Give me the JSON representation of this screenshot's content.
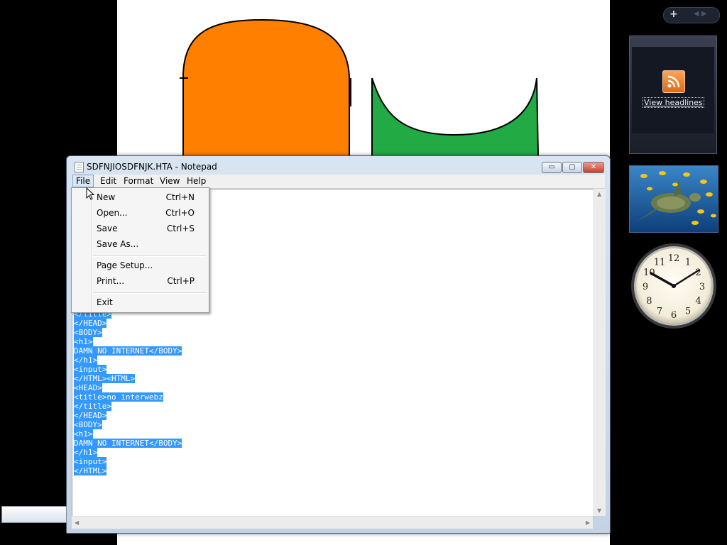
{
  "window": {
    "title": "SDFNJIOSDFNJK.HTA - Notepad",
    "min_glyph": "▭",
    "max_glyph": "▢",
    "close_glyph": "✕"
  },
  "menubar": [
    "File",
    "Edit",
    "Format",
    "View",
    "Help"
  ],
  "file_menu": {
    "items": [
      {
        "label": "New",
        "shortcut": "Ctrl+N"
      },
      {
        "label": "Open...",
        "shortcut": "Ctrl+O"
      },
      {
        "label": "Save",
        "shortcut": "Ctrl+S"
      },
      {
        "label": "Save As...",
        "shortcut": ""
      },
      {
        "label": "Page Setup...",
        "shortcut": ""
      },
      {
        "label": "Print...",
        "shortcut": "Ctrl+P"
      },
      {
        "label": "Exit",
        "shortcut": ""
      }
    ]
  },
  "editor": {
    "selection_color": "#3399ff",
    "lines": [
      "</title>",
      "</HEAD>",
      "<BODY>",
      "<h1>",
      "DAMN NO INTERNET</BODY>",
      "</h1>",
      "<input>",
      "</HTML><HTML>",
      "<HEAD>",
      "<title>no interwebz",
      "</title>",
      "</HEAD>",
      "<BODY>",
      "<h1>",
      "DAMN NO INTERNET</BODY>",
      "</h1>",
      "<input>",
      "</HTML>"
    ]
  },
  "sidebar": {
    "add_glyph": "+",
    "nav_glyphs": "◀ ▶",
    "feed_link": "View headlines",
    "clock": {
      "time": "1:50",
      "numbers": [
        "12",
        "1",
        "2",
        "3",
        "4",
        "5",
        "6",
        "7",
        "8",
        "9",
        "10",
        "11"
      ]
    }
  },
  "colors": {
    "orange_shape": "#ff7f00",
    "green_shape": "#22aa44"
  }
}
